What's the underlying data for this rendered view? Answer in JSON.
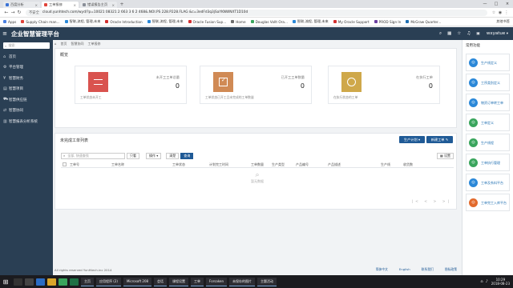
{
  "browser": {
    "tabs": [
      {
        "label": "百度分析",
        "color": "#3b73d6",
        "active": false
      },
      {
        "label": "工单报修",
        "color": "#e0443a",
        "active": true
      },
      {
        "label": "错误报告主页",
        "color": "#8a8f99",
        "active": false
      }
    ],
    "new_tab": "+",
    "url_security": "不安全",
    "url": "cloud.yunhtech.com/wyd/?p=10021 08321 2 663 3 6 2 468&.NOI.PS 228.P228.FLAG &c=3edFd3q3jSaYKNWNXT1D10d",
    "bookmarks": [
      {
        "label": "Apps",
        "color": "#4a7fe0"
      },
      {
        "label": "Supply Chain man...",
        "color": "#e0443a"
      },
      {
        "label": "智联,流程, 管理,未来",
        "color": "#2b88d8"
      },
      {
        "label": "Oracle Introduction",
        "color": "#d32f2f"
      },
      {
        "label": "智联,流程, 管理,未来",
        "color": "#2b88d8"
      },
      {
        "label": "Oracle Fusion Sup...",
        "color": "#d32f2f"
      },
      {
        "label": "Home",
        "color": "#6d6d6d"
      },
      {
        "label": "Douglas Vollt Ora...",
        "color": "#3aa55d"
      },
      {
        "label": "智联,流程, 管理,未来",
        "color": "#2b88d8"
      },
      {
        "label": "My Oracle Support",
        "color": "#d32f2f"
      },
      {
        "label": "PROD Sign In",
        "color": "#6b3fa0"
      },
      {
        "label": "McGraw Quarter...",
        "color": "#1f6fb2"
      }
    ],
    "other_bookmarks": "其他书签"
  },
  "header": {
    "title": "企业智慧管理平台",
    "user": "wxyatue"
  },
  "sidebar": {
    "search_placeholder": "搜索",
    "items": [
      {
        "label": "首页",
        "icon": "home-icon"
      },
      {
        "label": "平台管理",
        "icon": "settings-icon"
      },
      {
        "label": "智慧财务",
        "icon": "finance-icon"
      },
      {
        "label": "智慧项目",
        "icon": "project-icon"
      },
      {
        "label": "智慧供应链",
        "icon": "supply-icon"
      },
      {
        "label": "智慧协同",
        "icon": "collab-icon"
      },
      {
        "label": "智慧报表分析系统",
        "icon": "report-icon"
      }
    ]
  },
  "breadcrumb": [
    "首页",
    "智慧协同",
    "工单报修"
  ],
  "overview": {
    "title": "概览",
    "cards": [
      {
        "label": "未开工工单总量",
        "value": "0",
        "desc": "工单状态未开工",
        "color": "#d9534f",
        "icon": "list-icon"
      },
      {
        "label": "已开工工单数量",
        "value": "0",
        "desc": "工单状态已开工且未完成的工单数量",
        "color": "#d08a55",
        "icon": "checkbox-icon"
      },
      {
        "label": "在执行工单",
        "value": "0",
        "desc": "在执行状态的工单",
        "color": "#cfa84a",
        "icon": "circle-icon"
      }
    ]
  },
  "list": {
    "title": "未完成工单列表",
    "btn_create_plan": "生产计划",
    "btn_create_order": "新建工单",
    "search_placeholder": "全部, 快速查找",
    "btn_filter": "只看",
    "btn_ops": "操作",
    "btn_clear": "清楚",
    "btn_search": "查询",
    "btn_settings": "设置",
    "columns": [
      "工单号",
      "工单名称",
      "工单状态",
      "计划完工时间",
      "工单数量",
      "生产类型",
      "产品编号",
      "产品描述",
      "生产线",
      "收货数"
    ],
    "empty_text": "暂无数据",
    "pager": "|< < > >|"
  },
  "footer": {
    "copyright": "All rights reserved YunHtech.inc 2014",
    "links": [
      "简体中文",
      "English",
      "联系我们",
      "隐私政策"
    ]
  },
  "right_panel": {
    "title": "常用功能",
    "items": [
      {
        "label": "生产线定义",
        "color": "#2b88d8"
      },
      {
        "label": "工序类别定义",
        "color": "#2b88d8"
      },
      {
        "label": "物资订单转工单",
        "color": "#2b88d8"
      },
      {
        "label": "工单定义",
        "color": "#3aa55d"
      },
      {
        "label": "生产线程",
        "color": "#3aa55d"
      },
      {
        "label": "工单执行管理",
        "color": "#3aa55d"
      },
      {
        "label": "工单及系料平台",
        "color": "#2b88d8"
      },
      {
        "label": "工单完工入库平台",
        "color": "#e26a2c"
      }
    ]
  },
  "taskbar": {
    "apps": [
      "主页",
      "应用程序 (2)",
      "Microsoft 208",
      "会话",
      "课程设置",
      "工单",
      "Forsaken",
      "未保存的图片",
      "主题活动"
    ],
    "time": "10:29",
    "date": "2018-08-23"
  }
}
